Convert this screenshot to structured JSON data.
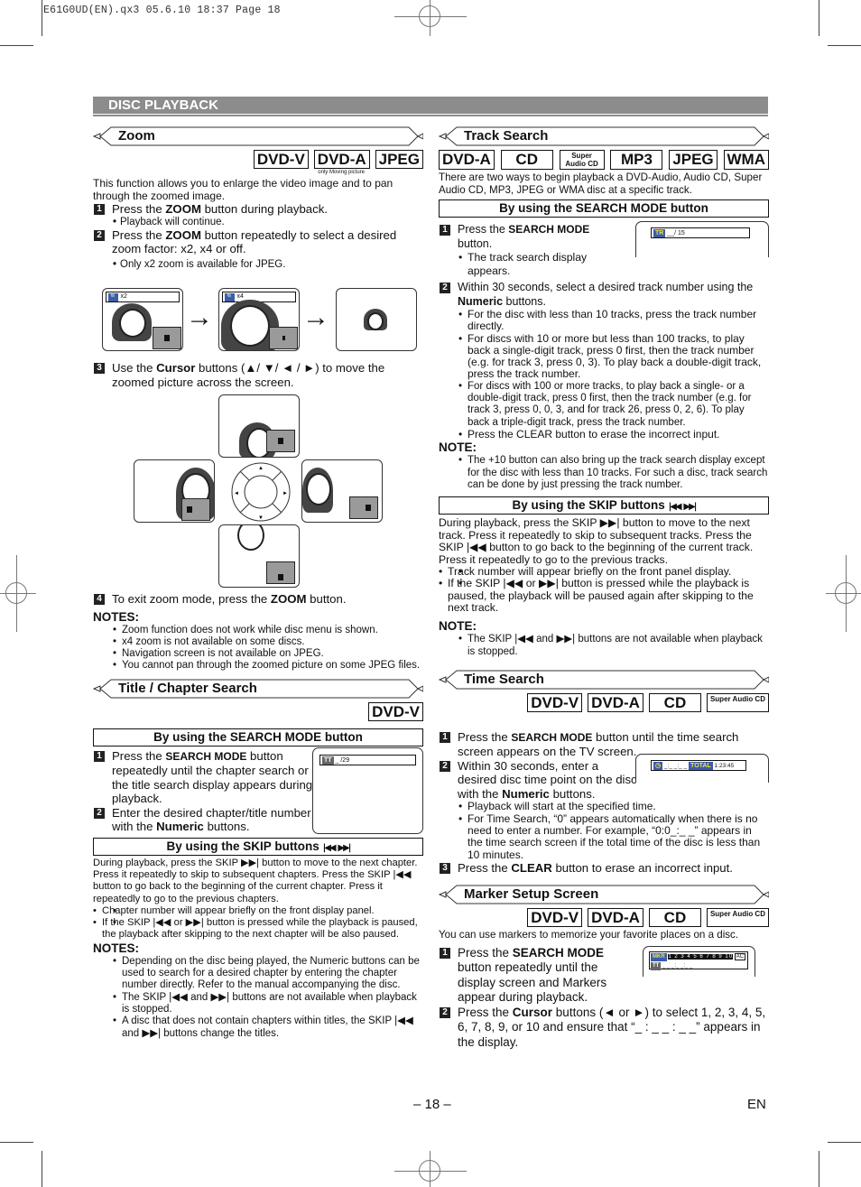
{
  "slug": "E61G0UD(EN).qx3  05.6.10 18:37  Page 18",
  "section_bar": "DISC PLAYBACK",
  "footer": {
    "page": "– 18 –",
    "lang": "EN"
  },
  "zoom": {
    "title": "Zoom",
    "badges": [
      "DVD-V",
      "DVD-A",
      "JPEG"
    ],
    "badge_note": "only Moving picture",
    "intro": "This function allows you to enlarge the video image and to pan through the zoomed image.",
    "step1_pre": "Press the ",
    "step1_bold": "ZOOM",
    "step1_post": " button during playback.",
    "step1_bullet": "Playback will continue.",
    "step2_pre": "Press the ",
    "step2_bold": "ZOOM",
    "step2_post": " button repeatedly to select a desired zoom factor: x2, x4 or off.",
    "step2_bullet": "Only x2 zoom is available for JPEG.",
    "osd_x2": "x2",
    "osd_x4": "x4",
    "step3_pre": "Use the ",
    "step3_bold": "Cursor",
    "step3_post": " buttons (▲/ ▼/ ◄ / ►) to move the zoomed picture across the screen.",
    "step4_pre": "To exit zoom mode, press the ",
    "step4_bold": "ZOOM",
    "step4_post": " button.",
    "notes_label": "NOTES:",
    "notes": [
      "Zoom function does not work while disc menu is shown.",
      "x4 zoom is not available on some discs.",
      "Navigation screen is not available on JPEG.",
      "You cannot pan through the zoomed picture on some JPEG files."
    ]
  },
  "title_chapter": {
    "title": "Title / Chapter Search",
    "badges": [
      "DVD-V"
    ],
    "sub1": "By using the SEARCH MODE button",
    "step1_pre": "Press the ",
    "step1_bold": "SEARCH MODE",
    "step1_post": " button repeatedly until the chapter search or the title search display appears during playback.",
    "step2_pre": "Enter the desired chapter/title number with the ",
    "step2_bold": "Numeric",
    "step2_post": " buttons.",
    "osd_tag": "TT",
    "osd_value": "_ /29",
    "sub2": "By using the SKIP buttons",
    "skip_p1": "During playback, press the SKIP ▶▶| button to move to the next chapter.  Press it repeatedly to skip to subsequent chapters. Press the SKIP |◀◀ button to go back to the beginning of the current chapter. Press it repeatedly to go to the previous chapters.",
    "skip_b1": "Chapter number will appear briefly on the front display panel.",
    "skip_b2": "If the SKIP |◀◀ or ▶▶| button is pressed while the playback is paused, the playback after skipping to the next chapter will be also paused.",
    "notes_label": "NOTES:",
    "notes": [
      "Depending on the disc being played, the Numeric buttons can be used to search for a desired chapter by entering the chapter number directly. Refer to the manual accompanying the disc.",
      "The SKIP |◀◀ and ▶▶| buttons are not available when playback is stopped.",
      "A disc that does not contain chapters within titles, the SKIP |◀◀ and ▶▶| buttons change the titles."
    ]
  },
  "track": {
    "title": "Track Search",
    "badges": [
      "DVD-A",
      "CD",
      "Super Audio CD",
      "MP3",
      "JPEG",
      "WMA"
    ],
    "intro": "There are two ways to begin playback a DVD-Audio, Audio CD, Super Audio CD, MP3, JPEG or WMA disc at a specific track.",
    "sub1": "By using the SEARCH MODE button",
    "step1_pre": "Press the ",
    "step1_bold": "SEARCH MODE",
    "step1_post": " button.",
    "step1_bullet": "The track search display appears.",
    "osd_tag": "TR",
    "osd_value": "__/ 15",
    "step2_pre": "Within 30 seconds, select a desired track number using the ",
    "step2_bold": "Numeric",
    "step2_post": " buttons.",
    "step2_bullets": [
      "For the disc with less than 10 tracks, press the track number directly.",
      "For discs with 10 or more but less than 100 tracks, to play back a single-digit track, press 0 first, then the track number (e.g. for track 3, press 0, 3). To play back a double-digit track, press the track number.",
      "For discs with 100 or more tracks, to play back a single- or a double-digit track, press 0 first, then the track number (e.g. for track 3, press 0, 0, 3, and for track 26, press 0, 2, 6). To play back a triple-digit track, press the track number.",
      "Press the CLEAR button to erase the incorrect input."
    ],
    "note_label": "NOTE:",
    "note": "The +10 button can also bring up the track search display except for the disc with less than 10 tracks. For such a disc, track search can be done by just pressing the track number.",
    "sub2": "By using the SKIP buttons",
    "skip_p1": "During playback, press the SKIP ▶▶| button to move to the next track. Press it repeatedly to skip to subsequent tracks. Press the SKIP |◀◀ button to go back to the beginning of the current track. Press it repeatedly to go to the previous tracks.",
    "skip_b1": "Track number will appear briefly on the front panel display.",
    "skip_b2": "If the SKIP |◀◀ or ▶▶| button is pressed while the playback is paused, the playback will be paused again after skipping to the next track.",
    "note2_label": "NOTE:",
    "note2": "The SKIP |◀◀ and ▶▶| buttons are not available when playback is stopped."
  },
  "time": {
    "title": "Time Search",
    "badges": [
      "DVD-V",
      "DVD-A",
      "CD",
      "Super Audio CD"
    ],
    "step1_pre": "Press the ",
    "step1_bold": "SEARCH MODE",
    "step1_post": " button until the time search screen appears on the TV screen.",
    "step2_pre": "Within 30 seconds, enter a desired disc time point on the disc with the ",
    "step2_bold": "Numeric",
    "step2_post": " buttons.",
    "bullets": [
      "Playback will start at the specified time.",
      "For Time Search, “0” appears automatically when there is no need to enter a number. For example, “0:0_:_ _” appears in the time search screen if the total time of the disc is less than 10 minutes."
    ],
    "step3_pre": "Press the ",
    "step3_bold": "CLEAR",
    "step3_post": " button to erase an incorrect input.",
    "osd_time": "_:_ _:_ _",
    "osd_total_tag": "TOTAL",
    "osd_total": "1:23:45"
  },
  "marker": {
    "title": "Marker Setup Screen",
    "badges": [
      "DVD-V",
      "DVD-A",
      "CD",
      "Super Audio CD"
    ],
    "intro": "You can use markers to memorize your favorite places on a disc.",
    "step1_pre": "Press the ",
    "step1_bold": "SEARCH MODE",
    "step1_post": " button repeatedly until the display screen and Markers appear during playback.",
    "step2_pre": "Press the ",
    "step2_bold": "Cursor",
    "step2_post": " buttons (◄ or ►) to select 1, 2, 3, 4, 5, 6, 7, 8, 9, or 10 and ensure that “_ : _ _ : _ _” appears in the display.",
    "osd_tag": "MKR",
    "osd_markers": "1 2 3 4 5 6 7 8 9 10",
    "osd_ac": "AC",
    "osd_tt": "TT",
    "osd_time": "_ _ _:_ _:_ _"
  }
}
